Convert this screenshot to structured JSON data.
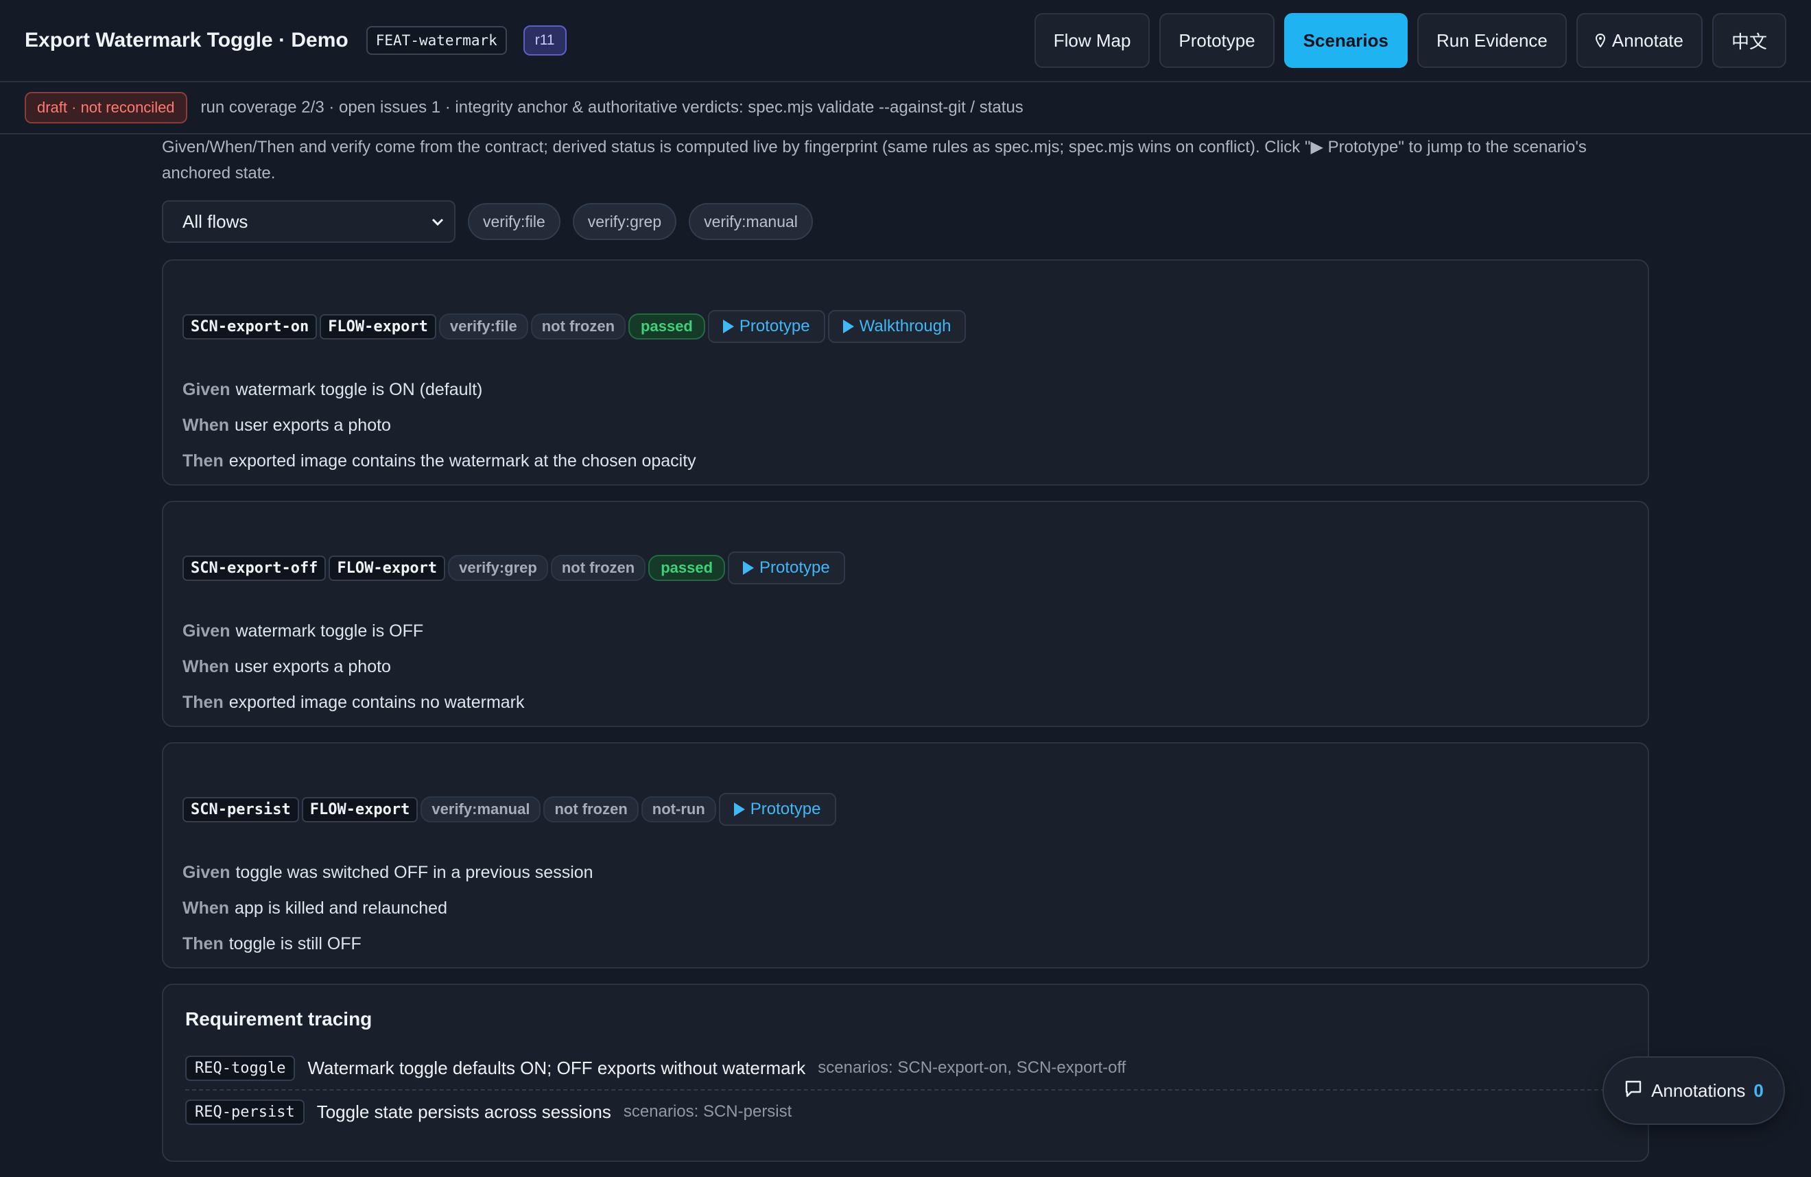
{
  "header": {
    "title": "Export Watermark Toggle · Demo",
    "feature_id": "FEAT-watermark",
    "revision": "r11",
    "nav": [
      {
        "label": "Flow Map",
        "active": false
      },
      {
        "label": "Prototype",
        "active": false
      },
      {
        "label": "Scenarios",
        "active": true
      },
      {
        "label": "Run Evidence",
        "active": false
      },
      {
        "label": "Annotate",
        "active": false
      },
      {
        "label": "中文",
        "active": false
      }
    ]
  },
  "status": {
    "badge": "draft · not reconciled",
    "text": "run coverage 2/3 · open issues 1 · integrity anchor & authoritative verdicts: spec.mjs validate --against-git / status"
  },
  "intro": "Given/When/Then and verify come from the contract; derived status is computed live by fingerprint (same rules as spec.mjs; spec.mjs wins on conflict). Click \"▶ Prototype\" to jump to the scenario's anchored state.",
  "filters": {
    "flow_select": "All flows",
    "pills": [
      "verify:file",
      "verify:grep",
      "verify:manual"
    ]
  },
  "scenarios": [
    {
      "id": "SCN-export-on",
      "flow": "FLOW-export",
      "verify": "verify:file",
      "frozen": "not frozen",
      "status": "passed",
      "prototype": "Prototype",
      "walkthrough": "Walkthrough",
      "given": "watermark toggle is ON (default)",
      "when": "user exports a photo",
      "then": "exported image contains the watermark at the chosen opacity"
    },
    {
      "id": "SCN-export-off",
      "flow": "FLOW-export",
      "verify": "verify:grep",
      "frozen": "not frozen",
      "status": "passed",
      "prototype": "Prototype",
      "given": "watermark toggle is OFF",
      "when": "user exports a photo",
      "then": "exported image contains no watermark"
    },
    {
      "id": "SCN-persist",
      "flow": "FLOW-export",
      "verify": "verify:manual",
      "frozen": "not frozen",
      "status": "not-run",
      "prototype": "Prototype",
      "given": "toggle was switched OFF in a previous session",
      "when": "app is killed and relaunched",
      "then": "toggle is still OFF"
    }
  ],
  "keywords": {
    "given": "Given",
    "when": "When",
    "then": "Then"
  },
  "requirements": {
    "title": "Requirement tracing",
    "rows": [
      {
        "id": "REQ-toggle",
        "text": "Watermark toggle defaults ON; OFF exports without watermark",
        "scenarios": "scenarios: SCN-export-on, SCN-export-off"
      },
      {
        "id": "REQ-persist",
        "text": "Toggle state persists across sessions",
        "scenarios": "scenarios: SCN-persist"
      }
    ]
  },
  "annotations": {
    "label": "Annotations",
    "count": "0"
  },
  "colors": {
    "accent": "#1fb3f2",
    "passed": "#3fd07a",
    "draft": "#ff7b72",
    "background": "#151b26"
  }
}
